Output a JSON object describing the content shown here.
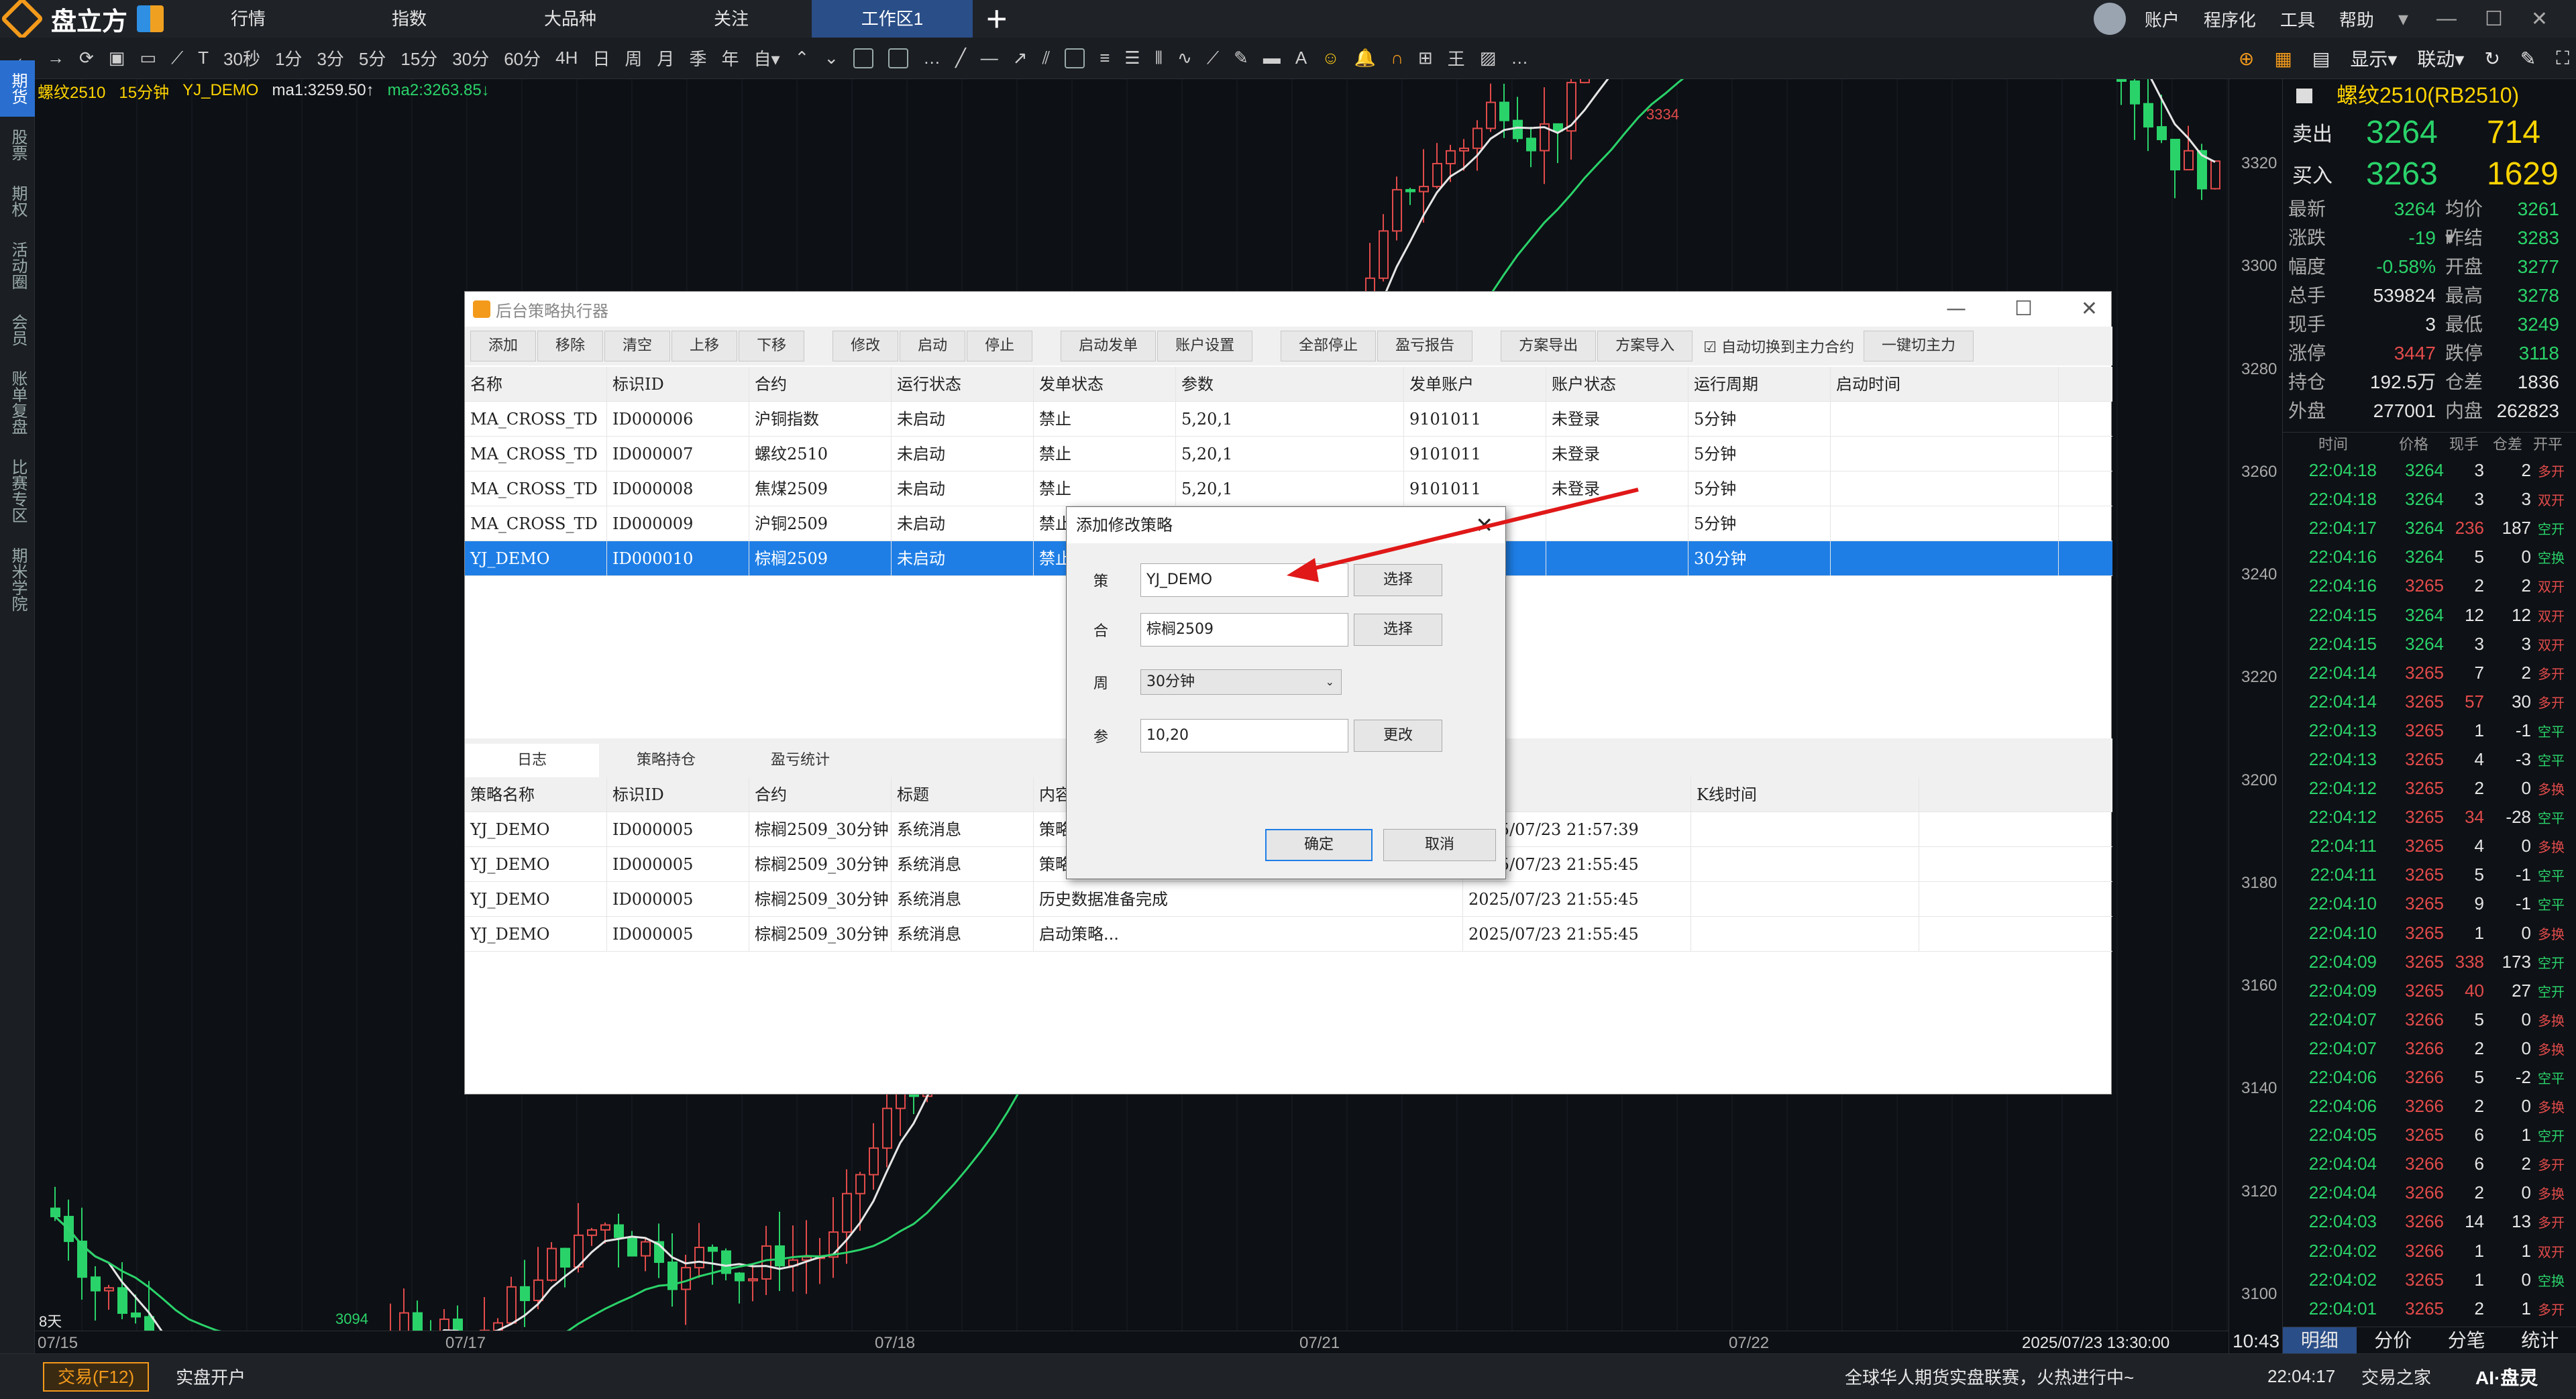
{
  "app": {
    "logo": "盘立方"
  },
  "topmenu": [
    "行情",
    "指数",
    "大品种",
    "关注",
    "工作区1"
  ],
  "topright": [
    "账户",
    "程序化",
    "工具",
    "帮助"
  ],
  "toolbar": {
    "periods": [
      "30秒",
      "1分",
      "3分",
      "5分",
      "15分",
      "30分",
      "60分",
      "4H",
      "日",
      "周",
      "月",
      "季",
      "年",
      "自▾"
    ],
    "right": [
      "显示▾",
      "联动▾"
    ]
  },
  "sidebar": [
    "期货",
    "股票",
    "期权",
    "活动圈",
    "会员",
    "账单复盘",
    "比赛专区",
    "期米学院"
  ],
  "chart": {
    "symbol": "螺纹2510",
    "period": "15分钟",
    "strategy": "YJ_DEMO",
    "ma1": "ma1:3259.50↑",
    "ma2": "ma2:3263.85↓",
    "high_label": "3334",
    "low_label": "3094",
    "days": "8天",
    "x_labels": [
      "07/15",
      "07/17",
      "07/18",
      "07/21",
      "07/22"
    ],
    "x_time": "2025/07/23 13:30:00",
    "y_labels": [
      "3320",
      "3300",
      "3280",
      "3260",
      "3240",
      "3220",
      "3200",
      "3180",
      "3160",
      "3140",
      "3120",
      "3100"
    ]
  },
  "quote": {
    "title": "螺纹2510(RB2510)",
    "sell_label": "卖出",
    "sell_price": "3264",
    "sell_vol": "714",
    "buy_label": "买入",
    "buy_price": "3263",
    "buy_vol": "1629",
    "stats": [
      [
        "最新",
        "3264",
        "均价▾",
        "3261"
      ],
      [
        "涨跌",
        "-19",
        "昨结",
        "3283"
      ],
      [
        "幅度",
        "-0.58%",
        "开盘",
        "3277"
      ],
      [
        "总手",
        "539824",
        "最高",
        "3278"
      ],
      [
        "现手",
        "3",
        "最低",
        "3249"
      ],
      [
        "涨停",
        "3447",
        "跌停",
        "3118"
      ],
      [
        "持仓",
        "192.5万",
        "仓差",
        "1836"
      ],
      [
        "外盘",
        "277001",
        "内盘",
        "262823"
      ]
    ],
    "tick_head": [
      "时间",
      "价格",
      "现手",
      "仓差",
      "开平"
    ],
    "ticks": [
      [
        "22:04:18",
        "3264",
        "3",
        "2",
        "多开"
      ],
      [
        "22:04:18",
        "3264",
        "3",
        "3",
        "双开"
      ],
      [
        "22:04:17",
        "3264",
        "236",
        "187",
        "空开"
      ],
      [
        "22:04:16",
        "3264",
        "5",
        "0",
        "空换"
      ],
      [
        "22:04:16",
        "3265",
        "2",
        "2",
        "双开"
      ],
      [
        "22:04:15",
        "3264",
        "12",
        "12",
        "双开"
      ],
      [
        "22:04:15",
        "3264",
        "3",
        "3",
        "双开"
      ],
      [
        "22:04:14",
        "3265",
        "7",
        "2",
        "多开"
      ],
      [
        "22:04:14",
        "3265",
        "57",
        "30",
        "多开"
      ],
      [
        "22:04:13",
        "3265",
        "1",
        "-1",
        "空平"
      ],
      [
        "22:04:13",
        "3265",
        "4",
        "-3",
        "空平"
      ],
      [
        "22:04:12",
        "3265",
        "2",
        "0",
        "多换"
      ],
      [
        "22:04:12",
        "3265",
        "34",
        "-28",
        "空平"
      ],
      [
        "22:04:11",
        "3265",
        "4",
        "0",
        "多换"
      ],
      [
        "22:04:11",
        "3265",
        "5",
        "-1",
        "空平"
      ],
      [
        "22:04:10",
        "3265",
        "9",
        "-1",
        "空平"
      ],
      [
        "22:04:10",
        "3265",
        "1",
        "0",
        "多换"
      ],
      [
        "22:04:09",
        "3265",
        "338",
        "173",
        "空开"
      ],
      [
        "22:04:09",
        "3265",
        "40",
        "27",
        "空开"
      ],
      [
        "22:04:07",
        "3266",
        "5",
        "0",
        "多换"
      ],
      [
        "22:04:07",
        "3266",
        "2",
        "0",
        "多换"
      ],
      [
        "22:04:06",
        "3266",
        "5",
        "-2",
        "空平"
      ],
      [
        "22:04:06",
        "3266",
        "2",
        "0",
        "多换"
      ],
      [
        "22:04:05",
        "3265",
        "6",
        "1",
        "空开"
      ],
      [
        "22:04:04",
        "3266",
        "6",
        "2",
        "多开"
      ],
      [
        "22:04:04",
        "3266",
        "2",
        "0",
        "多换"
      ],
      [
        "22:04:03",
        "3266",
        "14",
        "13",
        "多开"
      ],
      [
        "22:04:02",
        "3266",
        "1",
        "1",
        "双开"
      ],
      [
        "22:04:02",
        "3265",
        "1",
        "0",
        "空换"
      ],
      [
        "22:04:01",
        "3265",
        "2",
        "1",
        "多开"
      ]
    ],
    "time": "10:43",
    "footer": [
      "明细",
      "分价",
      "分笔",
      "统计"
    ]
  },
  "status": {
    "trade": "交易(F12)",
    "open": "实盘开户",
    "news": "全球华人期货实盘联赛，火热进行中~",
    "time": "22:04:17",
    "home": "交易之家",
    "ai": "AI·盘灵"
  },
  "dialog": {
    "title": "后台策略执行器",
    "buttons": [
      [
        "添加",
        "移除",
        "清空",
        "上移",
        "下移"
      ],
      [
        "修改",
        "启动",
        "停止"
      ],
      [
        "启动发单",
        "账户设置"
      ],
      [
        "全部停止",
        "盈亏报告"
      ],
      [
        "方案导出",
        "方案导入"
      ]
    ],
    "auto_switch": "自动切换到主力合约",
    "one_click": "一键切主力",
    "columns": [
      "名称",
      "标识ID",
      "合约",
      "运行状态",
      "发单状态",
      "参数",
      "发单账户",
      "账户状态",
      "运行周期",
      "启动时间"
    ],
    "rows": [
      [
        "MA_CROSS_TD",
        "ID000006",
        "沪铜指数",
        "未启动",
        "禁止",
        "5,20,1",
        "9101011",
        "未登录",
        "5分钟",
        ""
      ],
      [
        "MA_CROSS_TD",
        "ID000007",
        "螺纹2510",
        "未启动",
        "禁止",
        "5,20,1",
        "9101011",
        "未登录",
        "5分钟",
        ""
      ],
      [
        "MA_CROSS_TD",
        "ID000008",
        "焦煤2509",
        "未启动",
        "禁止",
        "5,20,1",
        "9101011",
        "未登录",
        "5分钟",
        ""
      ],
      [
        "MA_CROSS_TD",
        "ID000009",
        "沪铜2509",
        "未启动",
        "禁止",
        "",
        "",
        "",
        "5分钟",
        ""
      ],
      [
        "YJ_DEMO",
        "ID000010",
        "棕榈2509",
        "未启动",
        "禁止",
        "",
        "",
        "",
        "30分钟",
        ""
      ]
    ],
    "tabs": [
      "日志",
      "策略持仓",
      "盈亏统计"
    ],
    "log_columns": [
      "策略名称",
      "标识ID",
      "合约",
      "标题",
      "内容",
      "",
      "K线时间"
    ],
    "logs": [
      [
        "YJ_DEMO",
        "ID000005",
        "棕榈2509_30分钟",
        "系统消息",
        "策略已停",
        "2025/07/23 21:57:39",
        ""
      ],
      [
        "YJ_DEMO",
        "ID000005",
        "棕榈2509_30分钟",
        "系统消息",
        "策略加载",
        "2025/07/23 21:55:45",
        ""
      ],
      [
        "YJ_DEMO",
        "ID000005",
        "棕榈2509_30分钟",
        "系统消息",
        "历史数据准备完成",
        "2025/07/23 21:55:45",
        ""
      ],
      [
        "YJ_DEMO",
        "ID000005",
        "棕榈2509_30分钟",
        "系统消息",
        "启动策略...",
        "2025/07/23 21:55:45",
        ""
      ]
    ]
  },
  "subdialog": {
    "title": "添加修改策略",
    "strategy_label": "策",
    "strategy_value": "YJ_DEMO",
    "contract_label": "合",
    "contract_value": "棕榈2509",
    "period_label": "周",
    "period_value": "30分钟",
    "param_label": "参",
    "param_value": "10,20",
    "select": "选择",
    "change": "更改",
    "ok": "确定",
    "cancel": "取消"
  },
  "colors": {
    "up": "#e24b4b",
    "down": "#2ad36a",
    "accent": "#f39a1b",
    "selected": "#1e7ee6",
    "annotation_arrow": "#e01818"
  }
}
